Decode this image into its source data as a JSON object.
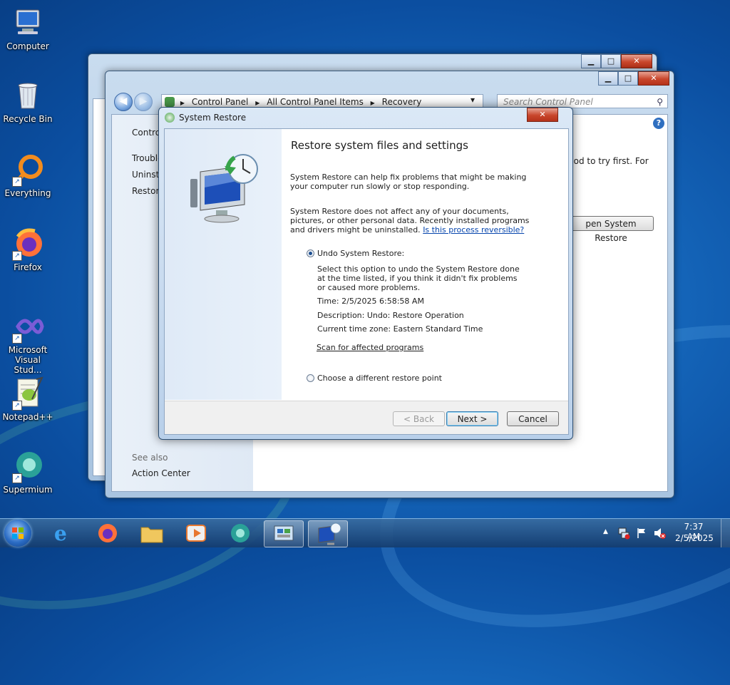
{
  "desktop": {
    "icons": [
      {
        "label": "Computer"
      },
      {
        "label": "Recycle Bin"
      },
      {
        "label": "Everything"
      },
      {
        "label": "Firefox"
      },
      {
        "label": "Microsoft Visual Stud..."
      },
      {
        "label": "Notepad++"
      },
      {
        "label": "Supermium"
      }
    ]
  },
  "control_panel": {
    "address": [
      "Control Panel",
      "All Control Panel Items",
      "Recovery"
    ],
    "search_placeholder": "Search Control Panel",
    "left_links": [
      "Contro",
      "Trouble",
      "Uninsta",
      "Restore"
    ],
    "see_also": "See also",
    "action_center": "Action Center",
    "body_text": "hod to try first. For",
    "open_button": "pen System Restore"
  },
  "dialog": {
    "title": "System Restore",
    "heading": "Restore system files and settings",
    "para1": "System Restore can help fix problems that might be making your computer run slowly or stop responding.",
    "para2": "System Restore does not affect any of your documents, pictures, or other personal data. Recently installed programs and drivers might be uninstalled.",
    "reversible_link": "Is this process reversible?",
    "option_undo": "Undo System Restore:",
    "undo_desc": "Select this option to undo the System Restore done at the time listed, if you think it didn't fix problems or caused more problems.",
    "time": "Time: 2/5/2025 6:58:58 AM",
    "description": "Description: Undo: Restore Operation",
    "timezone": "Current time zone: Eastern Standard Time",
    "scan_link": "Scan for affected programs",
    "option_choose": "Choose a different restore point",
    "back": "< Back",
    "next": "Next >",
    "cancel": "Cancel",
    "close_glyph": "✕"
  },
  "taskbar": {
    "time": "7:37 AM",
    "date": "2/5/2025"
  },
  "glyphs": {
    "minimize": "▁",
    "maximize": "□",
    "close": "✕",
    "back_arrow": "◀",
    "fwd_arrow": "▶",
    "dropdown": "▾",
    "search": "⚲",
    "help": "?",
    "show_hidden": "▲",
    "shortcut": "↗"
  },
  "colors": {
    "accent": "#1d4f91",
    "link": "#0645ad"
  }
}
